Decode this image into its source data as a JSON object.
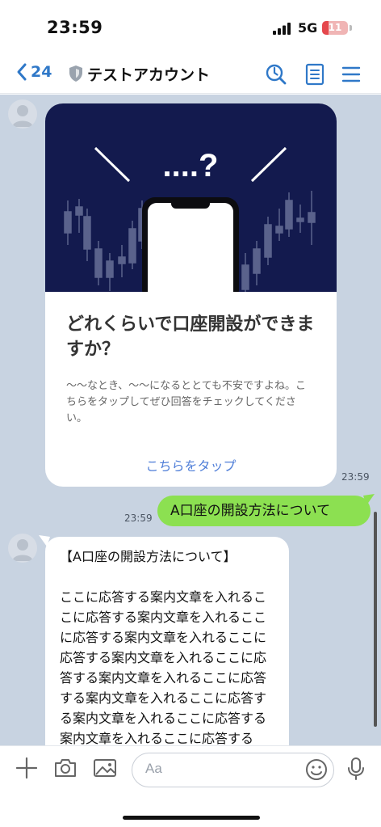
{
  "status_bar": {
    "time": "23:59",
    "network": "5G",
    "battery": "11"
  },
  "header": {
    "back_count": "24",
    "title": "テストアカウント"
  },
  "card": {
    "title": "どれくらいで口座開設ができますか？",
    "description": "〜〜なとき、〜〜になるととても不安ですよね。こちらをタップしてぜひ回答をチェックしてください。",
    "link": "こちらをタップ",
    "timestamp": "23:59",
    "hero_text": "....?"
  },
  "outgoing": {
    "text": "A口座の開設方法について",
    "timestamp": "23:59"
  },
  "incoming": {
    "text": "【A口座の開設方法について】\n\nここに応答する案内文章を入れるここに応答する案内文章を入れるここに応答する案内文章を入れるここに応答する案内文章を入れるここに応答する案内文章を入れるここに応答する案内文章を入れるここに応答する案内文章を入れるここに応答する案内文章を入れるここに応答する"
  },
  "input": {
    "placeholder": "Aa"
  },
  "colors": {
    "accent": "#2f78c8",
    "chat_bg": "#c8d3e1",
    "outgoing_bubble": "#8ce051",
    "hero_bg": "#131a4e",
    "link": "#4f7ed8"
  }
}
